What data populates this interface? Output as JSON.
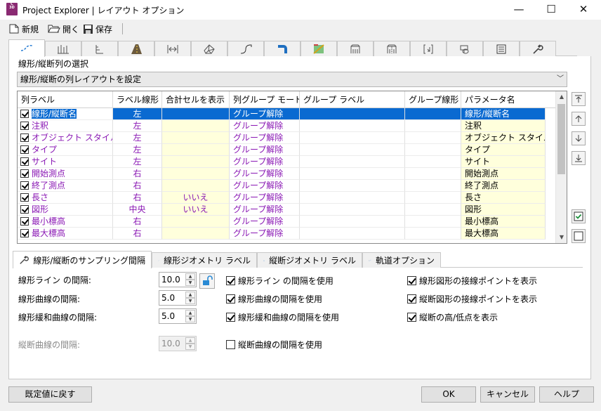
{
  "window": {
    "app_icon": "C",
    "app_icon_sub": "3D",
    "title": "Project Explorer | レイアウト オプション",
    "minimize": "—",
    "maximize": "☐",
    "close": "✕"
  },
  "toolbar": {
    "new_label": "新規",
    "open_label": "開く",
    "save_label": "保存"
  },
  "top_tabs": [
    "alignment-tab",
    "profile-view-tab",
    "profile-tab",
    "corridor-tab",
    "sample-line-tab",
    "surface-tab",
    "pipe-network-tab",
    "pressure-network-tab",
    "point-tab",
    "parcel-tab",
    "assembly-tab",
    "subassembly-tab",
    "sheet-tab",
    "view-frame-tab",
    "report-tab",
    "settings-tab"
  ],
  "section": {
    "label": "線形/縦断列の選択",
    "dropdown_value": "線形/縦断の列レイアウトを設定"
  },
  "grid": {
    "columns": [
      "列ラベル",
      "ラベル線形",
      "合計セルを表示",
      "列グループ モード",
      "グループ ラベル",
      "グループ線形",
      "パラメータ名"
    ],
    "rows": [
      {
        "label": "線形/縦断名",
        "align": "左",
        "total": "",
        "mode": "グループ解除",
        "glabel": "",
        "galign": "",
        "param": "線形/縦断名"
      },
      {
        "label": "注釈",
        "align": "左",
        "total": "",
        "mode": "グループ解除",
        "glabel": "",
        "galign": "",
        "param": "注釈"
      },
      {
        "label": "オブジェクト スタイル",
        "align": "左",
        "total": "",
        "mode": "グループ解除",
        "glabel": "",
        "galign": "",
        "param": "オブジェクト スタイル"
      },
      {
        "label": "タイプ",
        "align": "左",
        "total": "",
        "mode": "グループ解除",
        "glabel": "",
        "galign": "",
        "param": "タイプ"
      },
      {
        "label": "サイト",
        "align": "左",
        "total": "",
        "mode": "グループ解除",
        "glabel": "",
        "galign": "",
        "param": "サイト"
      },
      {
        "label": "開始測点",
        "align": "右",
        "total": "",
        "mode": "グループ解除",
        "glabel": "",
        "galign": "",
        "param": "開始測点"
      },
      {
        "label": "終了測点",
        "align": "右",
        "total": "",
        "mode": "グループ解除",
        "glabel": "",
        "galign": "",
        "param": "終了測点"
      },
      {
        "label": "長さ",
        "align": "右",
        "total": "いいえ",
        "mode": "グループ解除",
        "glabel": "",
        "galign": "",
        "param": "長さ"
      },
      {
        "label": "図形",
        "align": "中央",
        "total": "いいえ",
        "mode": "グループ解除",
        "glabel": "",
        "galign": "",
        "param": "図形"
      },
      {
        "label": "最小標高",
        "align": "右",
        "total": "",
        "mode": "グループ解除",
        "glabel": "",
        "galign": "",
        "param": "最小標高"
      },
      {
        "label": "最大標高",
        "align": "右",
        "total": "",
        "mode": "グループ解除",
        "glabel": "",
        "galign": "",
        "param": "最大標高"
      }
    ],
    "selected_row": 0
  },
  "side_buttons": [
    "move-to-top",
    "move-up",
    "move-down",
    "move-to-bottom",
    "check-all",
    "uncheck-all"
  ],
  "bottom_tabs": [
    {
      "label": "線形/縦断のサンプリング間隔",
      "icon": "wrench-icon"
    },
    {
      "label": "線形ジオメトリ ラベル",
      "icon": "alignment-icon"
    },
    {
      "label": "縦断ジオメトリ ラベル",
      "icon": "profile-icon"
    },
    {
      "label": "軌道オプション",
      "icon": "rail-icon"
    }
  ],
  "sampling": {
    "line_interval_label": "線形ライン の間隔:",
    "line_interval_value": "10.0",
    "curve_interval_label": "線形曲線の間隔:",
    "curve_interval_value": "5.0",
    "spiral_interval_label": "線形緩和曲線の間隔:",
    "spiral_interval_value": "5.0",
    "profile_curve_label": "縦断曲線の間隔:",
    "profile_curve_value": "10.0"
  },
  "checks": {
    "use_line_interval": {
      "label": "線形ライン の間隔を使用",
      "checked": true
    },
    "use_curve_interval": {
      "label": "線形曲線の間隔を使用",
      "checked": true
    },
    "use_spiral_interval": {
      "label": "線形緩和曲線の間隔を使用",
      "checked": true
    },
    "use_profile_curve": {
      "label": "縦断曲線の間隔を使用",
      "checked": false
    },
    "show_align_tangent": {
      "label": "線形図形の接線ポイントを表示",
      "checked": true
    },
    "show_profile_tangent": {
      "label": "縦断図形の接線ポイントを表示",
      "checked": true
    },
    "show_high_low": {
      "label": "縦断の高/低点を表示",
      "checked": true
    }
  },
  "footer": {
    "reset_label": "既定値に戻す",
    "ok_label": "OK",
    "cancel_label": "キャンセル",
    "help_label": "ヘルプ"
  },
  "colors": {
    "accent": "#0a6ad1",
    "purple_text": "#8a18b4",
    "cell_yellow": "#ffffdc"
  }
}
